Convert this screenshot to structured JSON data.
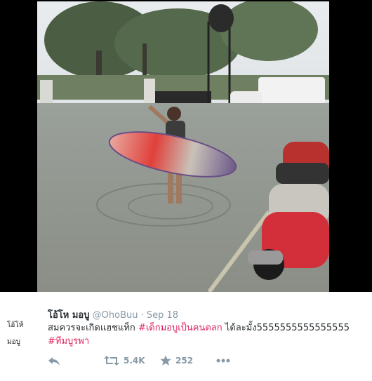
{
  "tweet": {
    "display_name": "โอ้โห มอบู",
    "handle": "@OhoBuu",
    "separator": "·",
    "date": "Sep 18",
    "text_main": "สมควรจะเกิดแฮชแท็ก ",
    "hashtag_1": "#เด็กมอบูเป็นคนตลก",
    "text_after": " ได้ละมั้ง5555555555555555",
    "hashtag_2": "#ทีมบูรพา",
    "avatar_text": "โอ้โห้ มอบู"
  },
  "actions": {
    "reply_icon": "reply-icon",
    "retweet_icon": "retweet-icon",
    "retweet_count": "5.4K",
    "like_icon": "star-icon",
    "like_count": "252",
    "more_icon": "more-icon"
  },
  "colors": {
    "hashtag": "#e0245e",
    "meta": "#8899a6",
    "text": "#292f33"
  }
}
